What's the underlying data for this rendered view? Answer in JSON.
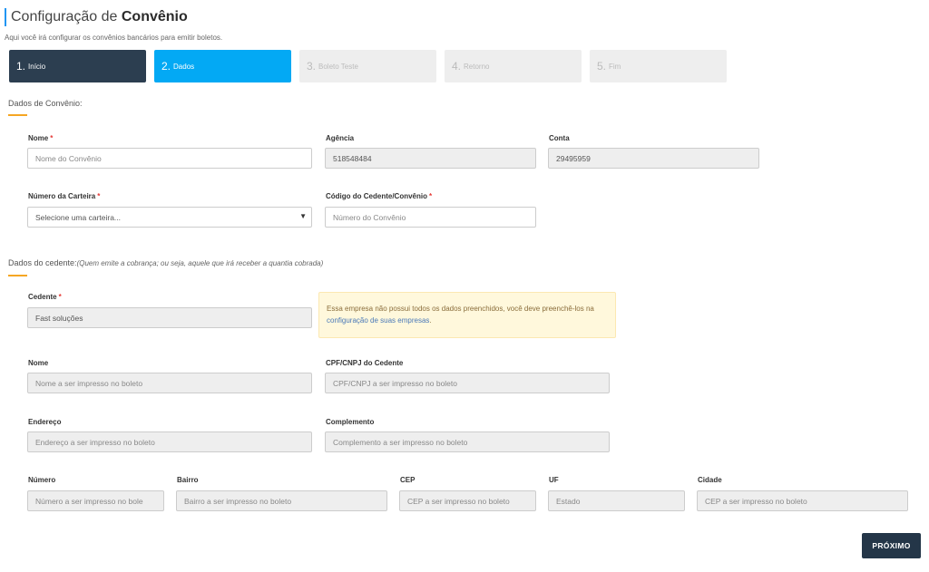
{
  "header": {
    "title_prefix": "Configuração de ",
    "title_bold": "Convênio",
    "subtitle": "Aqui você irá configurar os convênios bancários para emitir boletos."
  },
  "steps": [
    {
      "num": "1.",
      "label": "Início",
      "state": "done"
    },
    {
      "num": "2.",
      "label": "Dados",
      "state": "active"
    },
    {
      "num": "3.",
      "label": "Boleto Teste",
      "state": "inactive"
    },
    {
      "num": "4.",
      "label": "Retorno",
      "state": "inactive"
    },
    {
      "num": "5.",
      "label": "Fim",
      "state": "inactive"
    }
  ],
  "convenio": {
    "section_title": "Dados de Convênio:",
    "nome_label": "Nome",
    "nome_placeholder": "Nome do Convênio",
    "agencia_label": "Agência",
    "agencia_value": "518548484",
    "conta_label": "Conta",
    "conta_value": "29495959",
    "carteira_label": "Número da Carteira",
    "carteira_value": "Selecione uma carteira...",
    "codigo_label": "Código do Cedente/Convênio",
    "codigo_placeholder": "Número do Convênio"
  },
  "cedente": {
    "section_title": "Dados do cedente:",
    "section_hint": "(Quem emite a cobrança; ou seja, aquele que irá receber a quantia cobrada)",
    "cedente_label": "Cedente",
    "cedente_value": "Fast soluções",
    "alert_text": "Essa empresa não possui todos os dados preenchidos, você deve preenchê-los na ",
    "alert_link": "configuração de suas empresas",
    "alert_end": ".",
    "nome_label": "Nome",
    "nome_placeholder": "Nome a ser impresso no boleto",
    "cpf_label": "CPF/CNPJ do Cedente",
    "cpf_placeholder": "CPF/CNPJ a ser impresso no boleto",
    "endereco_label": "Endereço",
    "endereco_placeholder": "Endereço a ser impresso no boleto",
    "complemento_label": "Complemento",
    "complemento_placeholder": "Complemento a ser impresso no boleto",
    "numero_label": "Número",
    "numero_placeholder": "Número a ser impresso no bole",
    "bairro_label": "Bairro",
    "bairro_placeholder": "Bairro a ser impresso no boleto",
    "cep_label": "CEP",
    "cep_placeholder": "CEP a ser impresso no boleto",
    "uf_label": "UF",
    "uf_placeholder": "Estado",
    "cidade_label": "Cidade",
    "cidade_placeholder": "CEP a ser impresso no boleto"
  },
  "required_mark": "*",
  "next_button": "PRÓXIMO",
  "colors": {
    "accent": "#03a9f4",
    "step_done": "#2c3e50",
    "section_underline": "#f5a623",
    "required": "#e53935",
    "button": "#243648"
  }
}
